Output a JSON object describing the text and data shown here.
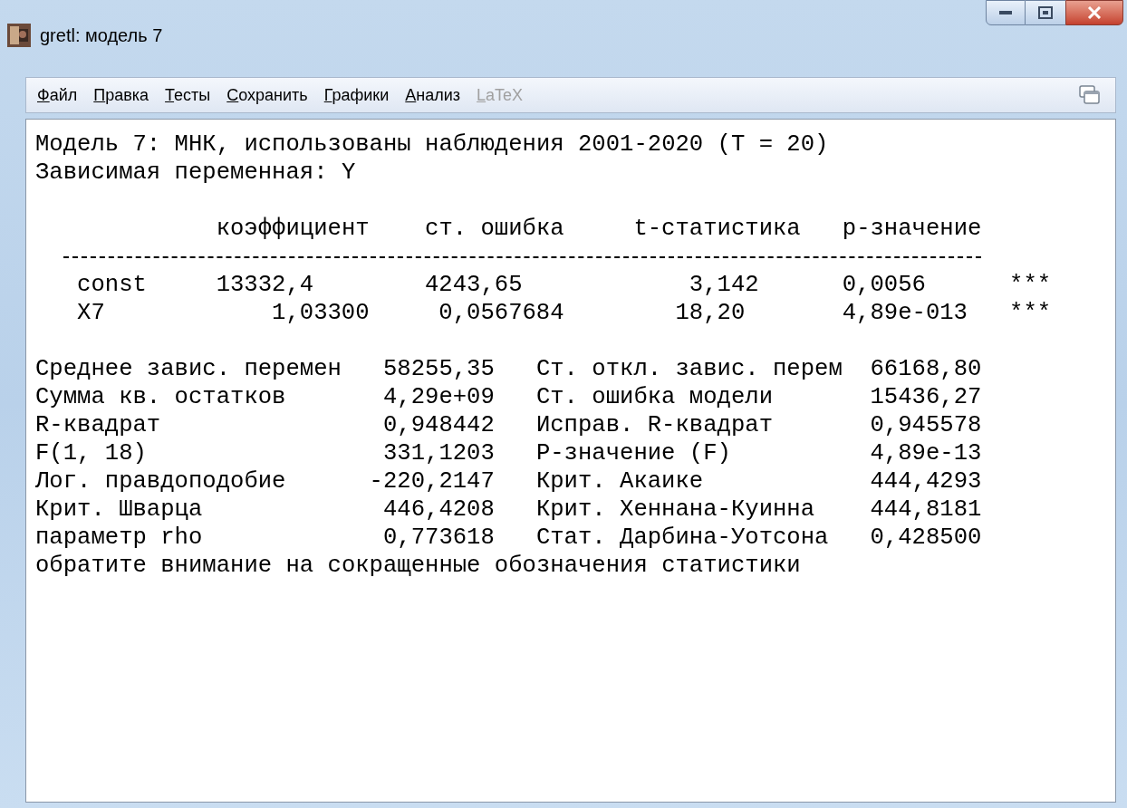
{
  "window": {
    "title": "gretl: модель 7"
  },
  "menu": [
    {
      "label": "Файл",
      "disabled": false
    },
    {
      "label": "Правка",
      "disabled": false
    },
    {
      "label": "Тесты",
      "disabled": false
    },
    {
      "label": "Сохранить",
      "disabled": false
    },
    {
      "label": "Графики",
      "disabled": false
    },
    {
      "label": "Анализ",
      "disabled": false
    },
    {
      "label": "LaTeX",
      "disabled": true
    }
  ],
  "output": {
    "header": [
      "Модель 7: МНК, использованы наблюдения 2001-2020 (T = 20)",
      "Зависимая переменная: Y"
    ],
    "coef_table": {
      "columns": [
        "коэффициент",
        "ст. ошибка",
        "t-статистика",
        "p-значение"
      ],
      "rows": [
        {
          "name": "const",
          "cells": [
            "13332,4",
            "4243,65",
            "3,142",
            "0,0056"
          ],
          "stars": "***"
        },
        {
          "name": "X7",
          "cells": [
            "1,03300",
            "0,0567684",
            "18,20",
            "4,89e-013"
          ],
          "stars": "***"
        }
      ]
    },
    "stats": [
      {
        "label1": "Среднее завис. перемен",
        "value1": "58255,35",
        "label2": "Ст. откл. завис. перем",
        "value2": "66168,80"
      },
      {
        "label1": "Сумма кв. остатков",
        "value1": "4,29e+09",
        "label2": "Ст. ошибка модели",
        "value2": "15436,27"
      },
      {
        "label1": "R-квадрат",
        "value1": "0,948442",
        "label2": "Исправ. R-квадрат",
        "value2": "0,945578"
      },
      {
        "label1": "F(1, 18)",
        "value1": "331,1203",
        "label2": "P-значение (F)",
        "value2": "4,89e-13"
      },
      {
        "label1": "Лог. правдоподобие",
        "value1": "-220,2147",
        "label2": "Крит. Акаике",
        "value2": "444,4293"
      },
      {
        "label1": "Крит. Шварца",
        "value1": "446,4208",
        "label2": "Крит. Хеннана-Куинна",
        "value2": "444,8181"
      },
      {
        "label1": "параметр rho",
        "value1": "0,773618",
        "label2": "Стат. Дарбина-Уотсона",
        "value2": "0,428500"
      }
    ],
    "note": "обратите внимание на сокращенные обозначения статистики"
  }
}
